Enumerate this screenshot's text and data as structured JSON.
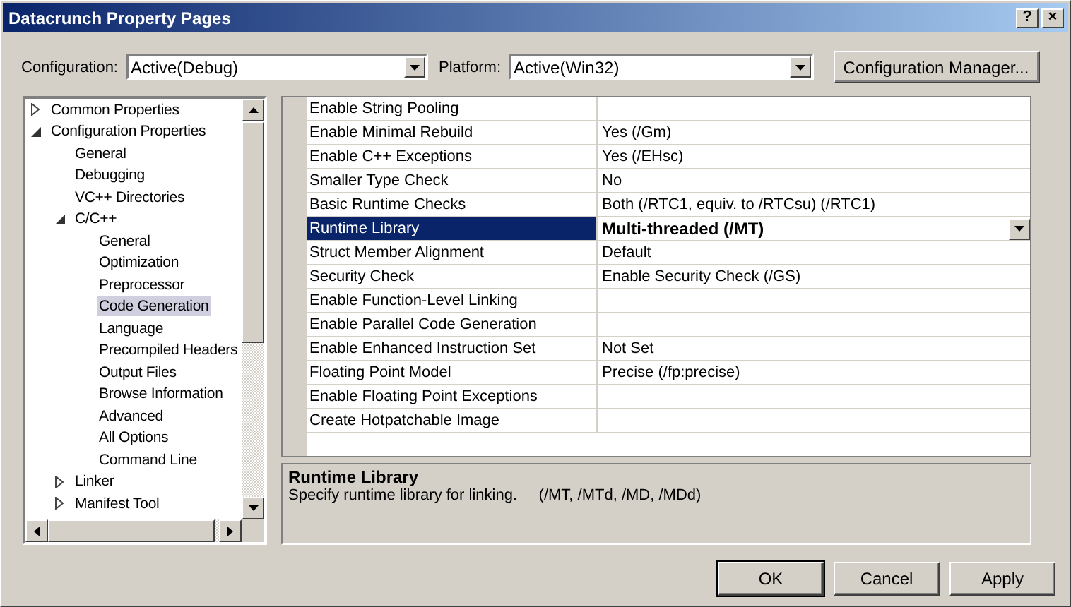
{
  "window": {
    "title": "Datacrunch Property Pages",
    "help_button": "?",
    "close_button": "×"
  },
  "configuration": {
    "label": "Configuration:",
    "value": "Active(Debug)"
  },
  "platform": {
    "label": "Platform:",
    "value": "Active(Win32)"
  },
  "configuration_manager_button": "Configuration Manager...",
  "tree": [
    {
      "label": "Common Properties",
      "expanded": false,
      "selected": false
    },
    {
      "label": "Configuration Properties",
      "expanded": true,
      "selected": false,
      "children": [
        {
          "label": "General",
          "selected": false
        },
        {
          "label": "Debugging",
          "selected": false
        },
        {
          "label": "VC++ Directories",
          "selected": false
        },
        {
          "label": "C/C++",
          "expanded": true,
          "selected": false,
          "children": [
            {
              "label": "General",
              "selected": false
            },
            {
              "label": "Optimization",
              "selected": false
            },
            {
              "label": "Preprocessor",
              "selected": false
            },
            {
              "label": "Code Generation",
              "selected": true
            },
            {
              "label": "Language",
              "selected": false
            },
            {
              "label": "Precompiled Headers",
              "selected": false
            },
            {
              "label": "Output Files",
              "selected": false
            },
            {
              "label": "Browse Information",
              "selected": false
            },
            {
              "label": "Advanced",
              "selected": false
            },
            {
              "label": "All Options",
              "selected": false
            },
            {
              "label": "Command Line",
              "selected": false
            }
          ]
        },
        {
          "label": "Linker",
          "expanded": false,
          "selected": false
        },
        {
          "label": "Manifest Tool",
          "expanded": false,
          "selected": false
        }
      ]
    }
  ],
  "properties": [
    {
      "name": "Enable String Pooling",
      "selected": false
    },
    {
      "name": "Enable Minimal Rebuild",
      "value": "Yes (/Gm)",
      "selected": false
    },
    {
      "name": "Enable C++ Exceptions",
      "value": "Yes (/EHsc)",
      "selected": false
    },
    {
      "name": "Smaller Type Check",
      "value": "No",
      "selected": false
    },
    {
      "name": "Basic Runtime Checks",
      "value": "Both (/RTC1, equiv. to /RTCsu) (/RTC1)",
      "selected": false
    },
    {
      "name": "Runtime Library",
      "value": "Multi-threaded (/MT)",
      "selected": true
    },
    {
      "name": "Struct Member Alignment",
      "value": "Default",
      "selected": false
    },
    {
      "name": "Security Check",
      "value": "Enable Security Check (/GS)",
      "selected": false
    },
    {
      "name": "Enable Function-Level Linking",
      "selected": false
    },
    {
      "name": "Enable Parallel Code Generation",
      "selected": false
    },
    {
      "name": "Enable Enhanced Instruction Set",
      "value": "Not Set",
      "selected": false
    },
    {
      "name": "Floating Point Model",
      "value": "Precise (/fp:precise)",
      "selected": false
    },
    {
      "name": "Enable Floating Point Exceptions",
      "selected": false
    },
    {
      "name": "Create Hotpatchable Image",
      "selected": false
    }
  ],
  "description": {
    "title": "Runtime Library",
    "text": "Specify runtime library for linking.     (/MT, /MTd, /MD, /MDd)"
  },
  "buttons": [
    {
      "label": "OK",
      "default": true
    },
    {
      "label": "Cancel",
      "default": false
    },
    {
      "label": "Apply",
      "default": false
    }
  ]
}
